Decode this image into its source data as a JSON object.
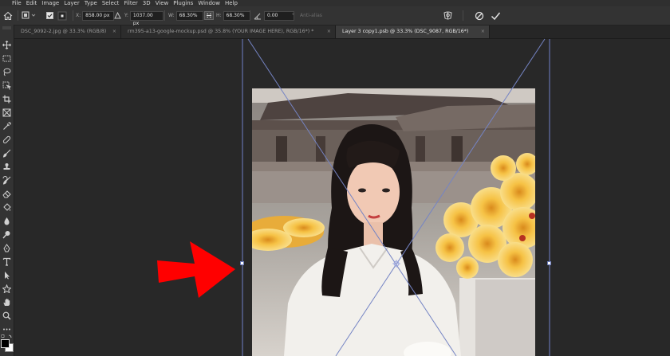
{
  "menu": [
    "File",
    "Edit",
    "Image",
    "Layer",
    "Type",
    "Select",
    "Filter",
    "3D",
    "View",
    "Plugins",
    "Window",
    "Help"
  ],
  "options": {
    "x_label": "X:",
    "x_value": "858.00 px",
    "y_label": "Y:",
    "y_value": "1037.00 px",
    "w_label": "W:",
    "w_value": "68.30%",
    "h_label": "H:",
    "h_value": "68.30%",
    "angle_value": "0.00",
    "angle_unit": "°",
    "antialias_label": "Anti-alias"
  },
  "tabs": [
    {
      "label": "DSC_9092-2.jpg @ 33.3% (RGB/8)",
      "active": false
    },
    {
      "label": "rm395-a13-google-mockup.psd @ 35.8% (YOUR IMAGE HERE), RGB/16*) *",
      "active": false
    },
    {
      "label": "Layer 3 copy1.psb @ 33.3% (DSC_9087, RGB/16*)",
      "active": true
    }
  ],
  "close_glyph": "×",
  "icons": {
    "home": "home-icon",
    "transform": "transform-icon",
    "cancel": "cancel-transform-icon",
    "commit": "commit-transform-icon",
    "warp": "warp-icon",
    "link": "link-icon"
  },
  "colors": {
    "arrow": "#ff0000",
    "bounding_box": "#6f80c8",
    "canvas": "#282828"
  }
}
